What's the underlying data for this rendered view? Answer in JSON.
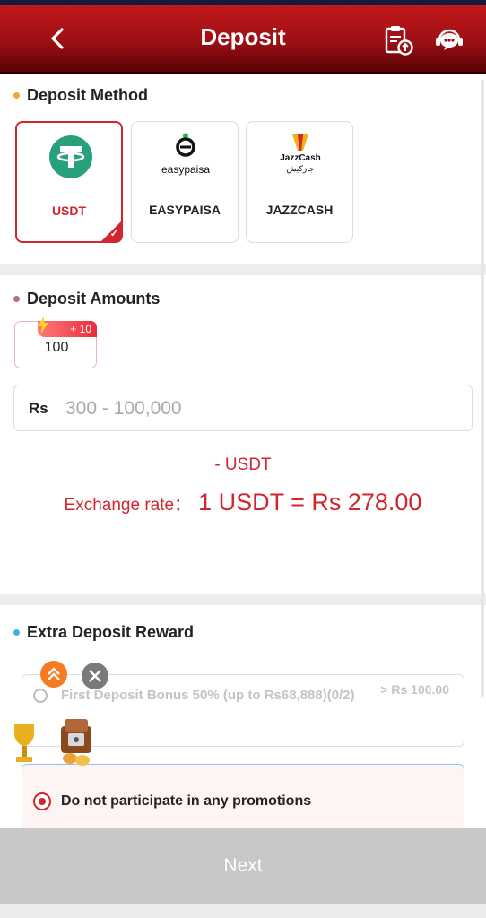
{
  "header": {
    "title": "Deposit"
  },
  "deposit_method": {
    "title": "Deposit Method",
    "methods": [
      {
        "label": "USDT",
        "logo_text": "",
        "selected": true
      },
      {
        "label": "EASYPAISA",
        "logo_text": "easypaisa",
        "selected": false
      },
      {
        "label": "JAZZCASH",
        "logo_text": "JazzCash",
        "logo_subtext": "جازکیش",
        "selected": false
      }
    ]
  },
  "deposit_amounts": {
    "title": "Deposit Amounts",
    "chip": {
      "value": "100",
      "badge": "+ 10"
    },
    "input": {
      "currency": "Rs",
      "placeholder": "300 - 100,000"
    },
    "usdt_line": "- USDT",
    "exchange_label": "Exchange rate：",
    "exchange_value": "1 USDT = Rs 278.00"
  },
  "reward": {
    "title": "Extra Deposit Reward",
    "option1": {
      "label": "First Deposit Bonus 50% (up to Rs68,888)(0/2)",
      "note": "> Rs 100.00"
    },
    "option2": {
      "label": "Do not participate in any promotions"
    }
  },
  "footer": {
    "next_label": "Next"
  },
  "colors": {
    "accent": "#d1262d",
    "header_top": "#c2181d",
    "header_bottom": "#5a0205"
  }
}
